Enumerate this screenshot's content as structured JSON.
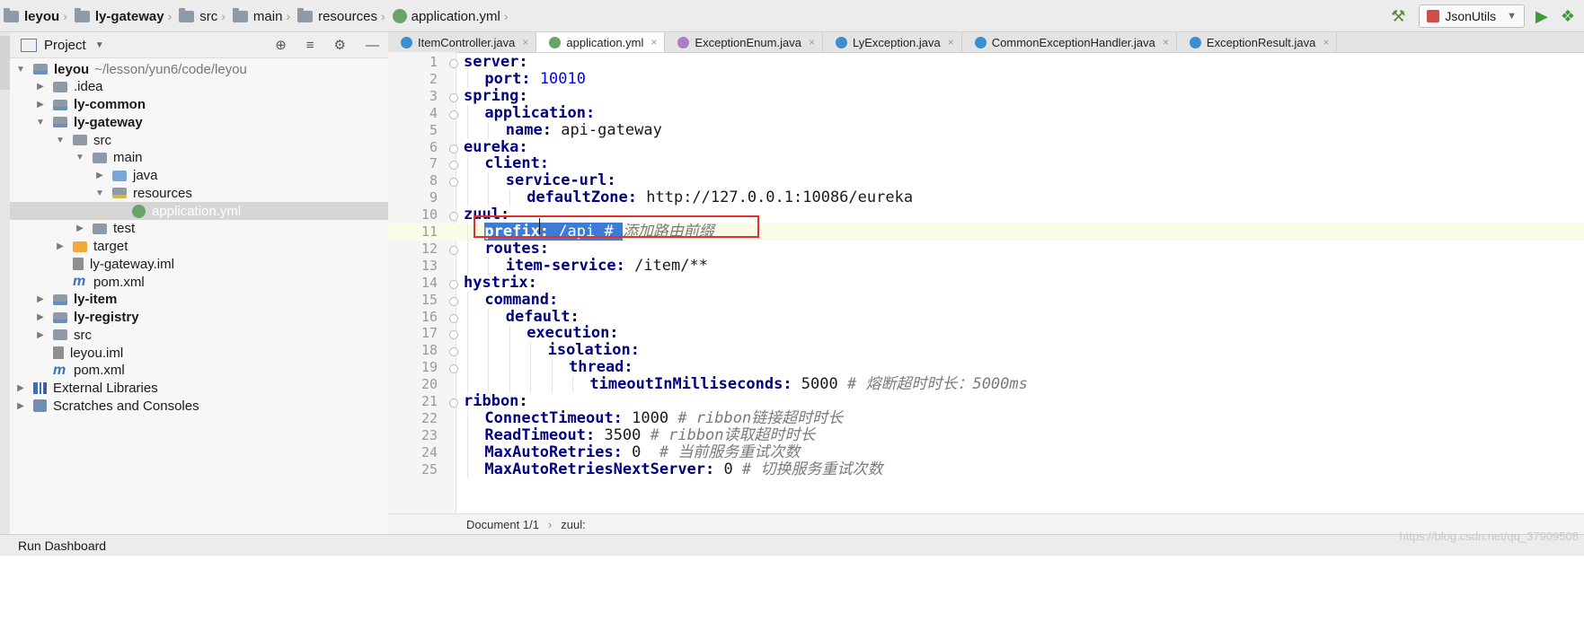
{
  "breadcrumb": [
    "leyou",
    "ly-gateway",
    "src",
    "main",
    "resources",
    "application.yml"
  ],
  "toolbar": {
    "run_config": "JsonUtils"
  },
  "project_panel": {
    "title": "Project",
    "tree": [
      {
        "label": "leyou",
        "bold": true,
        "path": "~/lesson/yun6/code/leyou",
        "depth": 0,
        "arrow": "down",
        "icon": "mod"
      },
      {
        "label": ".idea",
        "depth": 1,
        "arrow": "right",
        "icon": "folder"
      },
      {
        "label": "ly-common",
        "bold": true,
        "depth": 1,
        "arrow": "right",
        "icon": "mod"
      },
      {
        "label": "ly-gateway",
        "bold": true,
        "depth": 1,
        "arrow": "down",
        "icon": "mod"
      },
      {
        "label": "src",
        "depth": 2,
        "arrow": "down",
        "icon": "folder"
      },
      {
        "label": "main",
        "depth": 3,
        "arrow": "down",
        "icon": "folder"
      },
      {
        "label": "java",
        "depth": 4,
        "arrow": "right",
        "icon": "blue"
      },
      {
        "label": "resources",
        "depth": 4,
        "arrow": "down",
        "icon": "res"
      },
      {
        "label": "application.yml",
        "depth": 5,
        "arrow": "none",
        "icon": "yml",
        "selected": true
      },
      {
        "label": "test",
        "depth": 3,
        "arrow": "right",
        "icon": "folder"
      },
      {
        "label": "target",
        "depth": 2,
        "arrow": "right",
        "icon": "orange"
      },
      {
        "label": "ly-gateway.iml",
        "depth": 2,
        "arrow": "none",
        "icon": "iml"
      },
      {
        "label": "pom.xml",
        "depth": 2,
        "arrow": "none",
        "icon": "m"
      },
      {
        "label": "ly-item",
        "bold": true,
        "depth": 1,
        "arrow": "right",
        "icon": "mod"
      },
      {
        "label": "ly-registry",
        "bold": true,
        "depth": 1,
        "arrow": "right",
        "icon": "mod"
      },
      {
        "label": "src",
        "depth": 1,
        "arrow": "right",
        "icon": "folder"
      },
      {
        "label": "leyou.iml",
        "depth": 1,
        "arrow": "none",
        "icon": "iml"
      },
      {
        "label": "pom.xml",
        "depth": 1,
        "arrow": "none",
        "icon": "m"
      },
      {
        "label": "External Libraries",
        "depth": 0,
        "arrow": "right",
        "icon": "lib"
      },
      {
        "label": "Scratches and Consoles",
        "depth": 0,
        "arrow": "right",
        "icon": "scr"
      }
    ]
  },
  "tabs": [
    {
      "label": "ItemController.java",
      "icon": "c",
      "active": false
    },
    {
      "label": "application.yml",
      "icon": "y",
      "active": true
    },
    {
      "label": "ExceptionEnum.java",
      "icon": "e",
      "active": false
    },
    {
      "label": "LyException.java",
      "icon": "c",
      "active": false
    },
    {
      "label": "CommonExceptionHandler.java",
      "icon": "c",
      "active": false
    },
    {
      "label": "ExceptionResult.java",
      "icon": "c",
      "active": false
    }
  ],
  "code": [
    {
      "n": "1",
      "i": 0,
      "k": "server:",
      "v": "",
      "c": ""
    },
    {
      "n": "2",
      "i": 1,
      "k": "port:",
      "v": " 10010",
      "c": "",
      "num": true
    },
    {
      "n": "3",
      "i": 0,
      "k": "spring:",
      "v": "",
      "c": ""
    },
    {
      "n": "4",
      "i": 1,
      "k": "application:",
      "v": "",
      "c": ""
    },
    {
      "n": "5",
      "i": 2,
      "k": "name:",
      "v": " api-gateway",
      "c": ""
    },
    {
      "n": "6",
      "i": 0,
      "k": "eureka:",
      "v": "",
      "c": ""
    },
    {
      "n": "7",
      "i": 1,
      "k": "client:",
      "v": "",
      "c": ""
    },
    {
      "n": "8",
      "i": 2,
      "k": "service-url:",
      "v": "",
      "c": ""
    },
    {
      "n": "9",
      "i": 3,
      "k": "defaultZone:",
      "v": " http://127.0.0.1:10086/eureka",
      "c": ""
    },
    {
      "n": "10",
      "i": 0,
      "k": "zuul:",
      "v": "",
      "c": ""
    },
    {
      "n": "11",
      "i": 1,
      "k": "prefix:",
      "v": " /api # ",
      "c": "添加路由前缀",
      "selected": true
    },
    {
      "n": "12",
      "i": 1,
      "k": "routes:",
      "v": "",
      "c": ""
    },
    {
      "n": "13",
      "i": 2,
      "k": "item-service:",
      "v": " /item/**",
      "c": ""
    },
    {
      "n": "14",
      "i": 0,
      "k": "hystrix:",
      "v": "",
      "c": ""
    },
    {
      "n": "15",
      "i": 1,
      "k": "command:",
      "v": "",
      "c": ""
    },
    {
      "n": "16",
      "i": 2,
      "k": "default:",
      "v": "",
      "c": ""
    },
    {
      "n": "17",
      "i": 3,
      "k": "execution:",
      "v": "",
      "c": ""
    },
    {
      "n": "18",
      "i": 4,
      "k": "isolation:",
      "v": "",
      "c": ""
    },
    {
      "n": "19",
      "i": 5,
      "k": "thread:",
      "v": "",
      "c": ""
    },
    {
      "n": "20",
      "i": 6,
      "k": "timeoutInMilliseconds:",
      "v": " 5000 ",
      "c": "# 熔断超时时长：5000ms"
    },
    {
      "n": "21",
      "i": 0,
      "k": "ribbon:",
      "v": "",
      "c": ""
    },
    {
      "n": "22",
      "i": 1,
      "k": "ConnectTimeout:",
      "v": " 1000 ",
      "c": "# ribbon链接超时时长"
    },
    {
      "n": "23",
      "i": 1,
      "k": "ReadTimeout:",
      "v": " 3500 ",
      "c": "# ribbon读取超时时长"
    },
    {
      "n": "24",
      "i": 1,
      "k": "MaxAutoRetries:",
      "v": " 0  ",
      "c": "# 当前服务重试次数"
    },
    {
      "n": "25",
      "i": 1,
      "k": "MaxAutoRetriesNextServer:",
      "v": " 0 ",
      "c": "# 切换服务重试次数"
    }
  ],
  "statusbar": {
    "document": "Document 1/1",
    "chevron": "›",
    "path": "zuul:"
  },
  "bottom": {
    "run_dashboard": "Run Dashboard"
  },
  "watermark": "https://blog.csdn.net/qq_37909508"
}
